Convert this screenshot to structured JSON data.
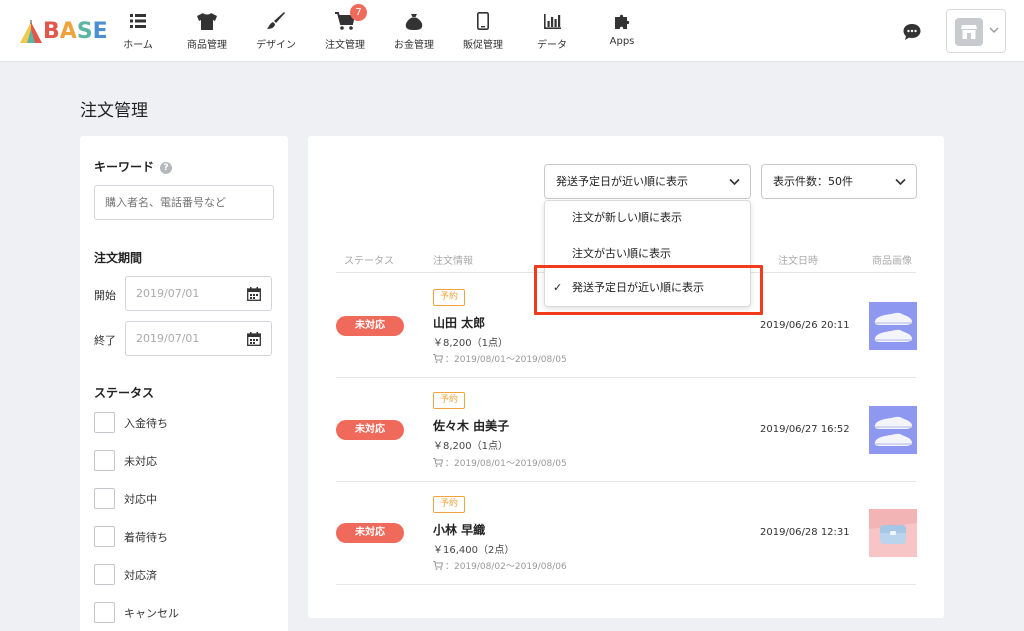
{
  "app": {
    "logo_text": [
      "B",
      "A",
      "S",
      "E"
    ]
  },
  "nav": {
    "items": [
      {
        "label": "ホーム",
        "icon": "list-icon"
      },
      {
        "label": "商品管理",
        "icon": "tshirt-icon"
      },
      {
        "label": "デザイン",
        "icon": "brush-icon"
      },
      {
        "label": "注文管理",
        "icon": "cart-icon",
        "badge": "7"
      },
      {
        "label": "お金管理",
        "icon": "money-bag-icon"
      },
      {
        "label": "販促管理",
        "icon": "smartphone-icon"
      },
      {
        "label": "データ",
        "icon": "bar-chart-icon"
      },
      {
        "label": "Apps",
        "icon": "puzzle-icon"
      }
    ]
  },
  "page": {
    "title": "注文管理"
  },
  "filters": {
    "keyword_label": "キーワード",
    "keyword_placeholder": "購入者名、電話番号など",
    "period_label": "注文期間",
    "start_label": "開始",
    "start_value": "2019/07/01",
    "end_label": "終了",
    "end_value": "2019/07/01",
    "status_label": "ステータス",
    "statuses": [
      "入金待ち",
      "未対応",
      "対応中",
      "着荷待ち",
      "対応済",
      "キャンセル"
    ]
  },
  "toolbar": {
    "sort_selected": "発送予定日が近い順に表示",
    "per_page": "表示件数：50件"
  },
  "sort_options": [
    "注文が新しい順に表示",
    "注文が古い順に表示",
    "発送予定日が近い順に表示"
  ],
  "sort_check": "✓",
  "table": {
    "headers": [
      "ステータス",
      "注文情報",
      "注文日時",
      "商品画像"
    ],
    "rows": [
      {
        "status": "未対応",
        "tag": "予約",
        "buyer": "山田 太郎",
        "price": "￥8,200（1点）",
        "ship": "：2019/08/01〜2019/08/05",
        "date": "2019/06/26 20:11",
        "image": "sneakers"
      },
      {
        "status": "未対応",
        "tag": "予約",
        "buyer": "佐々木 由美子",
        "price": "￥8,200（1点）",
        "ship": "：2019/08/01〜2019/08/05",
        "date": "2019/06/27 16:52",
        "image": "sneakers"
      },
      {
        "status": "未対応",
        "tag": "予約",
        "buyer": "小林 早織",
        "price": "￥16,400（2点）",
        "ship": "：2019/08/02〜2019/08/06",
        "date": "2019/06/28 12:31",
        "image": "pouch"
      }
    ]
  },
  "colors": {
    "accent": "#ef6a5a",
    "tag": "#f3a33b",
    "highlight": "#f23a1c",
    "sneaker_bg": "#8e98f0",
    "pouch_bg": "#f3b4b6"
  }
}
